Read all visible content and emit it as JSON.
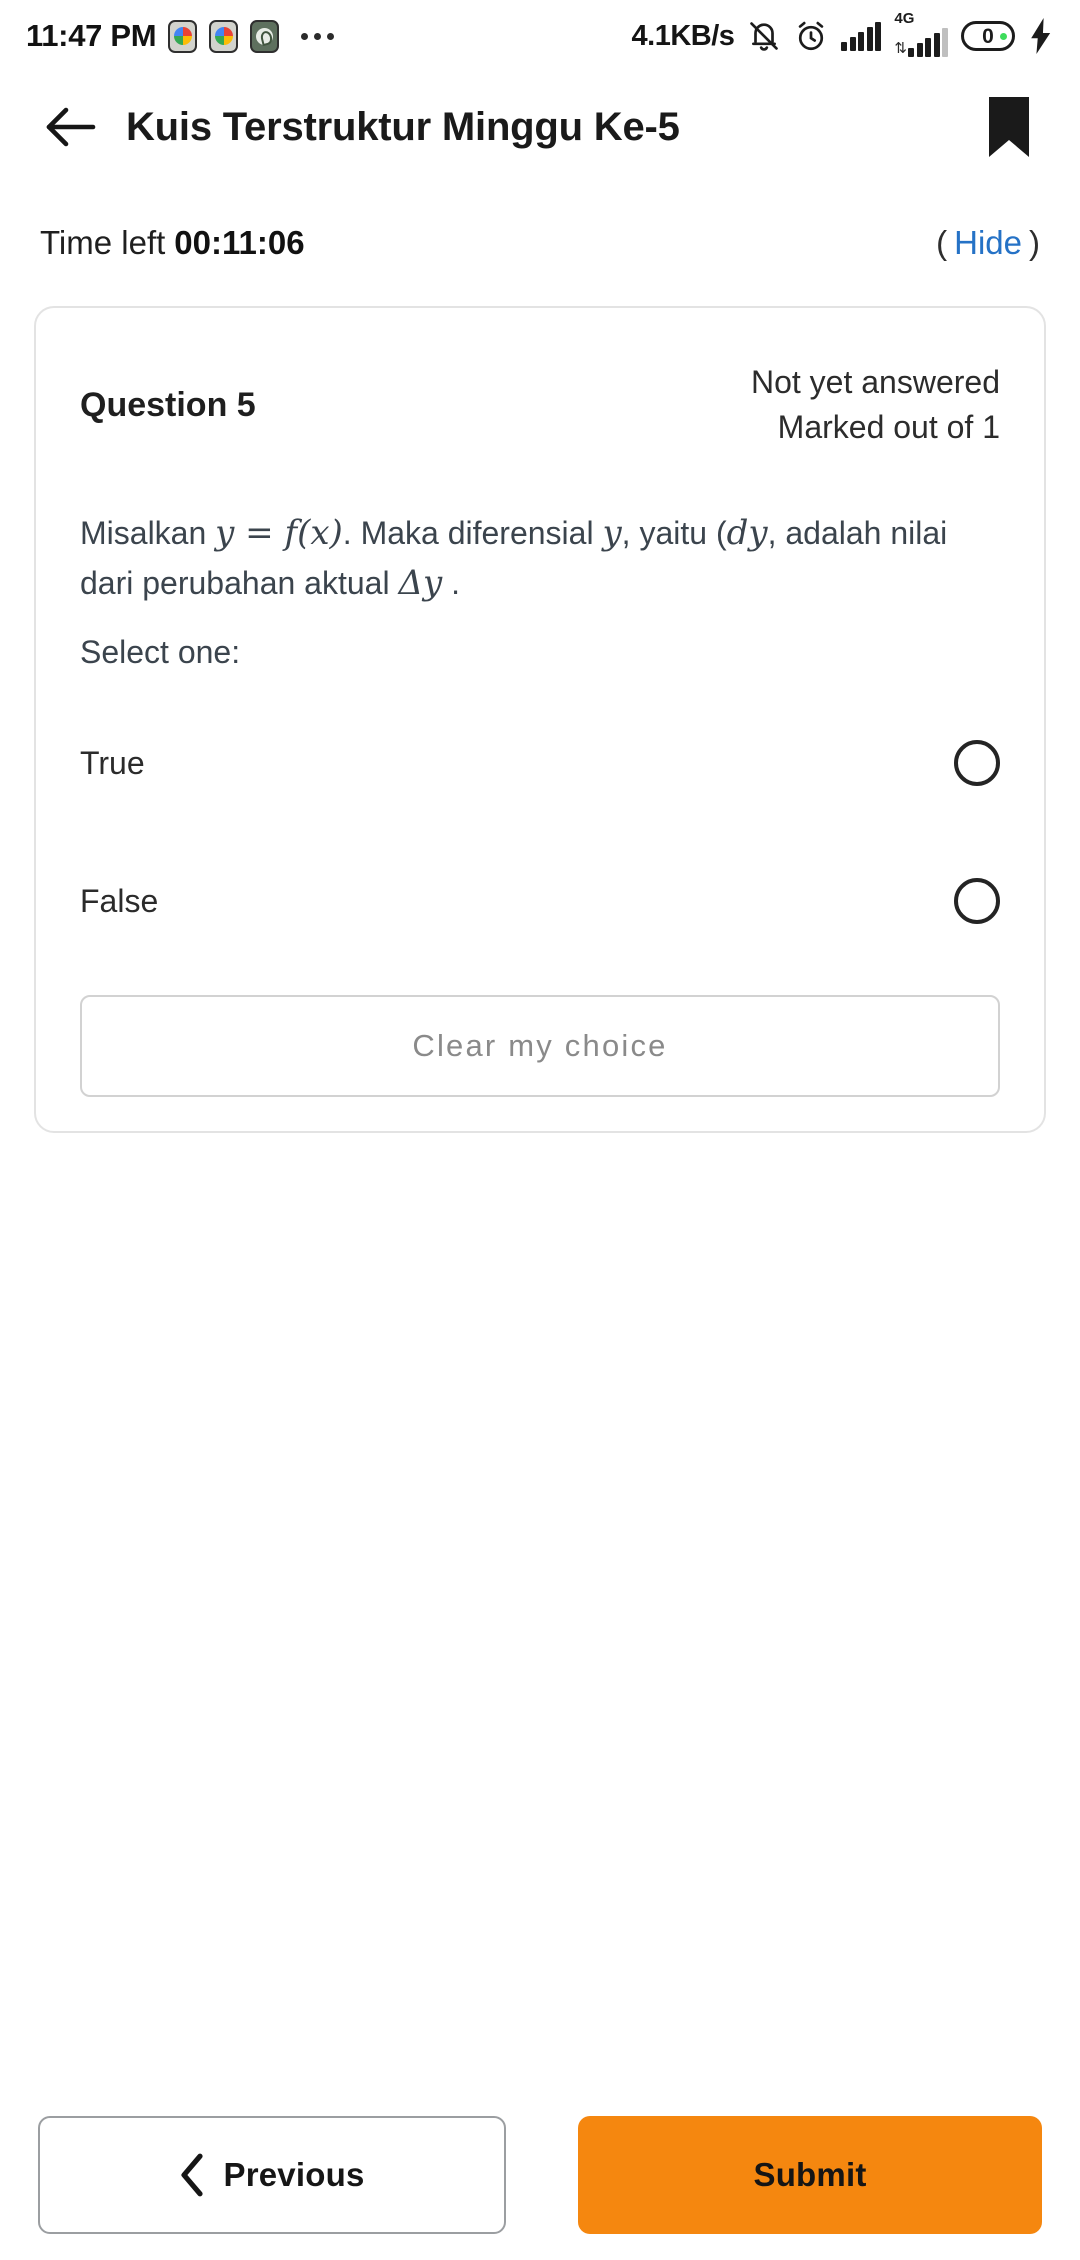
{
  "status_bar": {
    "time": "11:47 PM",
    "app_icons": [
      "photos-icon",
      "photos-icon",
      "whatsapp-icon"
    ],
    "overflow": "more-dots-icon",
    "network_speed": "4.1KB/s",
    "mute_icon": "bell-muted-icon",
    "alarm_icon": "alarm-clock-icon",
    "signal_1": "signal-bars-icon",
    "signal_2": "signal-bars-4g-icon",
    "network_type": "4G",
    "data_arrows": "⇅",
    "battery_level": "0",
    "charging_icon": "charging-bolt-icon"
  },
  "header": {
    "back_icon": "back-arrow-icon",
    "title": "Kuis Terstruktur Minggu Ke-5",
    "bookmark_icon": "bookmark-icon"
  },
  "timer": {
    "label": "Time left",
    "value": "00:11:06",
    "paren_open": "(",
    "hide_label": "Hide",
    "paren_close": ")"
  },
  "question": {
    "number_label": "Question 5",
    "status": "Not yet answered",
    "marks": "Marked out of 1",
    "text_part1": "Misalkan ",
    "math_y1": "y",
    "math_eq": " = ",
    "math_fx": "f(x)",
    "text_part2": ". Maka diferensial ",
    "math_y2": "y",
    "text_part3": ", yaitu (",
    "math_dy": "dy",
    "text_part4": ", adalah nilai dari perubahan aktual ",
    "math_delta_y": "Δy",
    "text_part5": " .",
    "select_prompt": "Select one:",
    "options": [
      {
        "label": "True",
        "selected": false
      },
      {
        "label": "False",
        "selected": false
      }
    ],
    "clear_label": "Clear my choice"
  },
  "bottom_bar": {
    "previous_label": "Previous",
    "previous_icon": "chevron-left-icon",
    "submit_label": "Submit"
  },
  "colors": {
    "accent_orange": "#f5870f",
    "link_blue": "#2572c6",
    "battery_green": "#3ddc5b",
    "card_border": "#e3e3e3",
    "text_dark": "#1f1f1f",
    "text_body": "#3b444d",
    "muted_gray": "#8a8a8a"
  }
}
